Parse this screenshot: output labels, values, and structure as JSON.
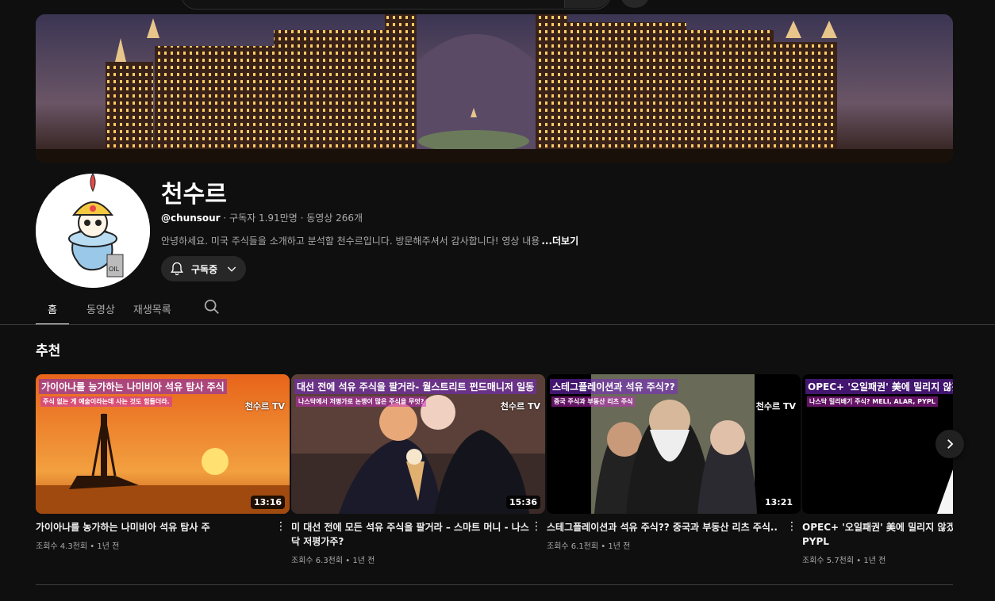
{
  "channel": {
    "name": "천수르",
    "handle": "@chunsour",
    "stats": " · 구독자 1.91만명 · 동영상 266개",
    "description": "안녕하세요.  미국 주식들을 소개하고 분석할 천수르입니다. 방문해주셔서 감사합니다!  영상 내용",
    "more_label": "...더보기",
    "subscribe_label": "구독중"
  },
  "tabs": [
    "홈",
    "동영상",
    "재생목록"
  ],
  "section": {
    "title": "추천"
  },
  "videos": [
    {
      "title": "가이아나를 농가하는 나미비아 석유 탐사 주",
      "views": "조회수 4.3천회 • 1년 전",
      "duration": "13:16",
      "overlay_title": "가이아나를 능가하는 나미비아 석유 탐사 주식",
      "overlay_sub": "주식 없는 게 예술이라는데 사는 것도 힘들더라.",
      "brand": "천수르 TV"
    },
    {
      "title": "미 대선 전에 모든 석유 주식을 팔거라 – 스마트 머니 - 나스닥 저평가주?",
      "views": "조회수 6.3천회 • 1년 전",
      "duration": "15:36",
      "overlay_title": "대선 전에 석유 주식을 팔거라- 월스트리트 펀드매니저 일동",
      "overlay_sub": "나스닥에서 저평가로 논쟁이 많은 주식을 무엇?",
      "brand": "천수르 TV"
    },
    {
      "title": "스테그플레이션과 석유 주식?? 중국과 부동산 리츠 주식..",
      "views": "조회수 6.1천회 • 1년 전",
      "duration": "13:21",
      "overlay_title": "스테그플레이션과 석유 주식??",
      "overlay_sub": "중국 주식과 부동산 리츠 주식",
      "brand": "천수르 TV"
    },
    {
      "title": "OPEC+ '오일패권' 美에 밀리지 않겠다 MELI, ALAR, PYPL",
      "views": "조회수 5.7천회 • 1년 전",
      "duration": "",
      "overlay_title": "OPEC+ '오일패권' 美에 밀리지 않겠다",
      "overlay_sub": "나스닥 밀리배기 주식? MELI, ALAR, PYPL",
      "brand": ""
    }
  ],
  "colors": {
    "background": "#0f0f0f",
    "accent_text": "#f1f1f1",
    "muted": "#aaaaaa"
  }
}
